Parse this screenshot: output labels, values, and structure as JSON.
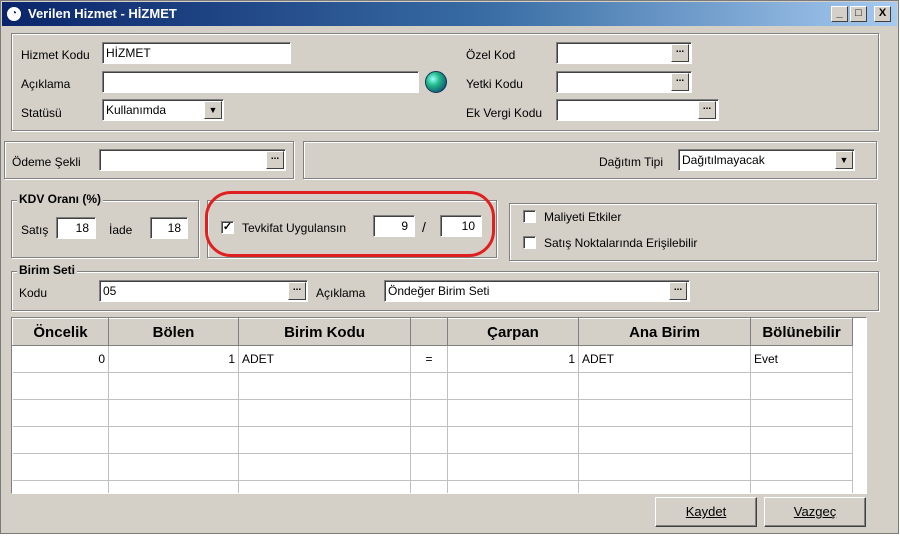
{
  "window": {
    "title": "Verilen Hizmet - HİZMET",
    "minimize": "_",
    "maximize": "□",
    "close": "X"
  },
  "main": {
    "hizmet_kodu_label": "Hizmet Kodu",
    "hizmet_kodu_value": "HİZMET",
    "aciklama_label": "Açıklama",
    "aciklama_value": "",
    "statusu_label": "Statüsü",
    "statusu_value": "Kullanımda",
    "ozel_kod_label": "Özel Kod",
    "ozel_kod_value": "",
    "yetki_kodu_label": "Yetki Kodu",
    "yetki_kodu_value": "",
    "ek_vergi_kodu_label": "Ek Vergi Kodu",
    "ek_vergi_kodu_value": "",
    "dots": "..."
  },
  "odeme": {
    "label": "Ödeme Şekli",
    "value": "",
    "dagitim_tipi_label": "Dağıtım Tipi",
    "dagitim_tipi_value": "Dağıtılmayacak"
  },
  "kdv": {
    "title": "KDV Oranı (%)",
    "satis_label": "Satış",
    "satis_value": "18",
    "iade_label": "İade",
    "iade_value": "18"
  },
  "tevkifat": {
    "checked": true,
    "check_mark": "✓",
    "label": "Tevkifat Uygulansın",
    "numerator": "9",
    "separator": "/",
    "denominator": "10"
  },
  "options": {
    "maliyeti_etkiler_label": "Maliyeti Etkiler",
    "maliyeti_etkiler_checked": false,
    "satis_noktalari_label": "Satış Noktalarında Erişilebilir",
    "satis_noktalari_checked": false
  },
  "birim_seti": {
    "title": "Birim Seti",
    "kodu_label": "Kodu",
    "kodu_value": "05",
    "aciklama_label": "Açıklama",
    "aciklama_value": "Öndeğer Birim Seti"
  },
  "grid": {
    "columns": [
      "Öncelik",
      "Bölen",
      "Birim Kodu",
      "",
      "Çarpan",
      "Ana Birim",
      "Bölünebilir"
    ],
    "rows": [
      [
        "0",
        "1",
        "ADET",
        "=",
        "1",
        "ADET",
        "Evet"
      ],
      [
        "",
        "",
        "",
        "",
        "",
        "",
        ""
      ],
      [
        "",
        "",
        "",
        "",
        "",
        "",
        ""
      ],
      [
        "",
        "",
        "",
        "",
        "",
        "",
        ""
      ],
      [
        "",
        "",
        "",
        "",
        "",
        "",
        ""
      ],
      [
        "",
        "",
        "",
        "",
        "",
        "",
        ""
      ]
    ]
  },
  "buttons": {
    "kaydet": "Kaydet",
    "vazgec": "Vazgeç"
  },
  "colors": {
    "title_start": "#0a246a",
    "title_end": "#a6caf0",
    "highlight": "#e02020",
    "face": "#d4d0c8"
  }
}
